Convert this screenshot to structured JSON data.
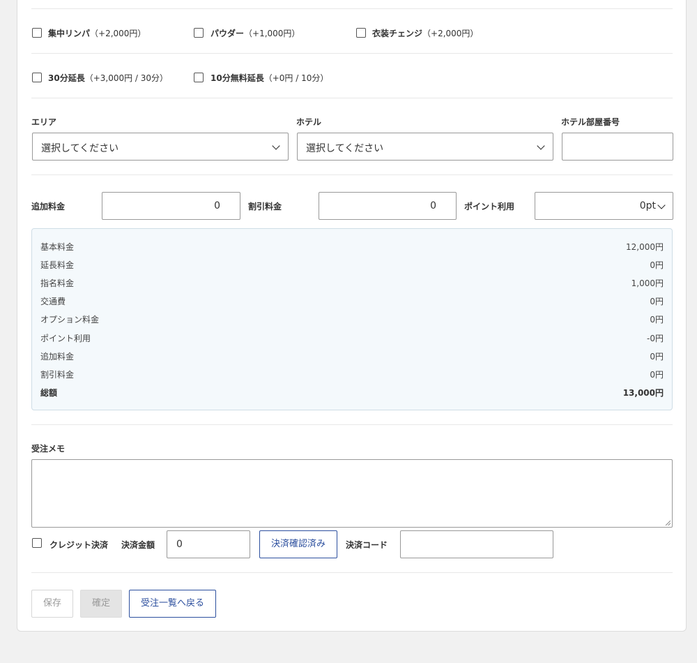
{
  "options_row1": [
    {
      "name": "集中リンパ",
      "price": "（+2,000円）"
    },
    {
      "name": "パウダー",
      "price": "（+1,000円）"
    },
    {
      "name": "衣装チェンジ",
      "price": "（+2,000円）"
    }
  ],
  "options_row2": [
    {
      "name": "30分延長",
      "price": "（+3,000円 / 30分）"
    },
    {
      "name": "10分無料延長",
      "price": "（+0円 / 10分）"
    }
  ],
  "location": {
    "area_label": "エリア",
    "area_value": "選択してください",
    "hotel_label": "ホテル",
    "hotel_value": "選択してください",
    "room_label": "ホテル部屋番号",
    "room_value": ""
  },
  "fees": {
    "additional_label": "追加料金",
    "additional_value": "0",
    "discount_label": "割引料金",
    "discount_value": "0",
    "point_label": "ポイント利用",
    "point_value": "0pt"
  },
  "summary": [
    {
      "label": "基本料金",
      "value": "12,000円"
    },
    {
      "label": "延長料金",
      "value": "0円"
    },
    {
      "label": "指名料金",
      "value": "1,000円"
    },
    {
      "label": "交通費",
      "value": "0円"
    },
    {
      "label": "オプション料金",
      "value": "0円"
    },
    {
      "label": "ポイント利用",
      "value": "-0円"
    },
    {
      "label": "追加料金",
      "value": "0円"
    },
    {
      "label": "割引料金",
      "value": "0円"
    },
    {
      "label": "総額",
      "value": "13,000円"
    }
  ],
  "memo": {
    "label": "受注メモ",
    "value": ""
  },
  "payment": {
    "credit_label": "クレジット決済",
    "amount_label": "決済金額",
    "amount_value": "0",
    "confirm_button": "決済確認済み",
    "code_label": "決済コード",
    "code_value": ""
  },
  "actions": {
    "save": "保存",
    "confirm": "確定",
    "back": "受注一覧へ戻る"
  }
}
